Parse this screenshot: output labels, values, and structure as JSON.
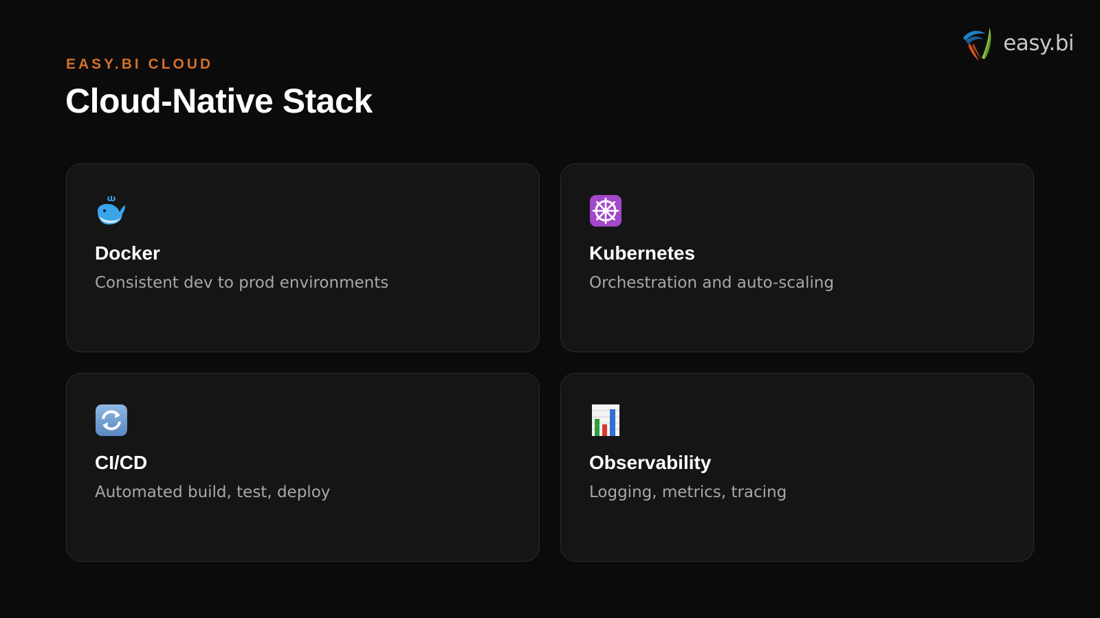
{
  "brand": {
    "logo_text": "easy.bi",
    "logo_icon": "easy-bi-logo-icon"
  },
  "header": {
    "eyebrow": "EASY.BI CLOUD",
    "title": "Cloud-Native Stack"
  },
  "cards": [
    {
      "icon": "docker-whale-icon",
      "title": "Docker",
      "description": "Consistent dev to prod environments"
    },
    {
      "icon": "kubernetes-wheel-icon",
      "title": "Kubernetes",
      "description": "Orchestration and auto-scaling"
    },
    {
      "icon": "refresh-cycle-icon",
      "title": "CI/CD",
      "description": "Automated build, test, deploy"
    },
    {
      "icon": "bar-chart-icon",
      "title": "Observability",
      "description": "Logging, metrics, tracing"
    }
  ],
  "colors": {
    "background": "#0b0b0b",
    "card": "#151515",
    "card_border": "#2d2d2d",
    "accent": "#d46f2c",
    "title": "#ffffff",
    "description": "#a8a8a8"
  }
}
